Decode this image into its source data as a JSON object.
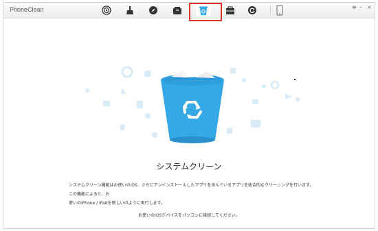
{
  "app": {
    "name": "PhoneClean"
  },
  "toolbar": {
    "tools": [
      {
        "icon": "fingerprint-icon"
      },
      {
        "icon": "broom-icon"
      },
      {
        "icon": "safari-compass-icon"
      },
      {
        "icon": "briefcase-box-icon"
      },
      {
        "icon": "trash-clean-icon",
        "active": true
      },
      {
        "icon": "toolbox-icon"
      },
      {
        "icon": "refresh-icon"
      },
      {
        "icon": "phone-icon"
      }
    ],
    "window_controls": {
      "menu": "≡",
      "minimize": "–",
      "close": "×"
    }
  },
  "main": {
    "heading": "システムクリーン",
    "description_line1": "システムクリーン機能はお使いのiOS、さらにアンインストールしたアプリを含んでいるアプリを総合的なクリーニングを行います。この機能によると、お",
    "description_line2": "使いのiPhone / iPadを新しいのように実行します。",
    "note": "お使いのiOSデバイスをパソコンに接続してください。"
  },
  "colors": {
    "accent": "#35a8e6",
    "highlight": "#e0312f",
    "faint_icon": "#cfe8f6"
  }
}
